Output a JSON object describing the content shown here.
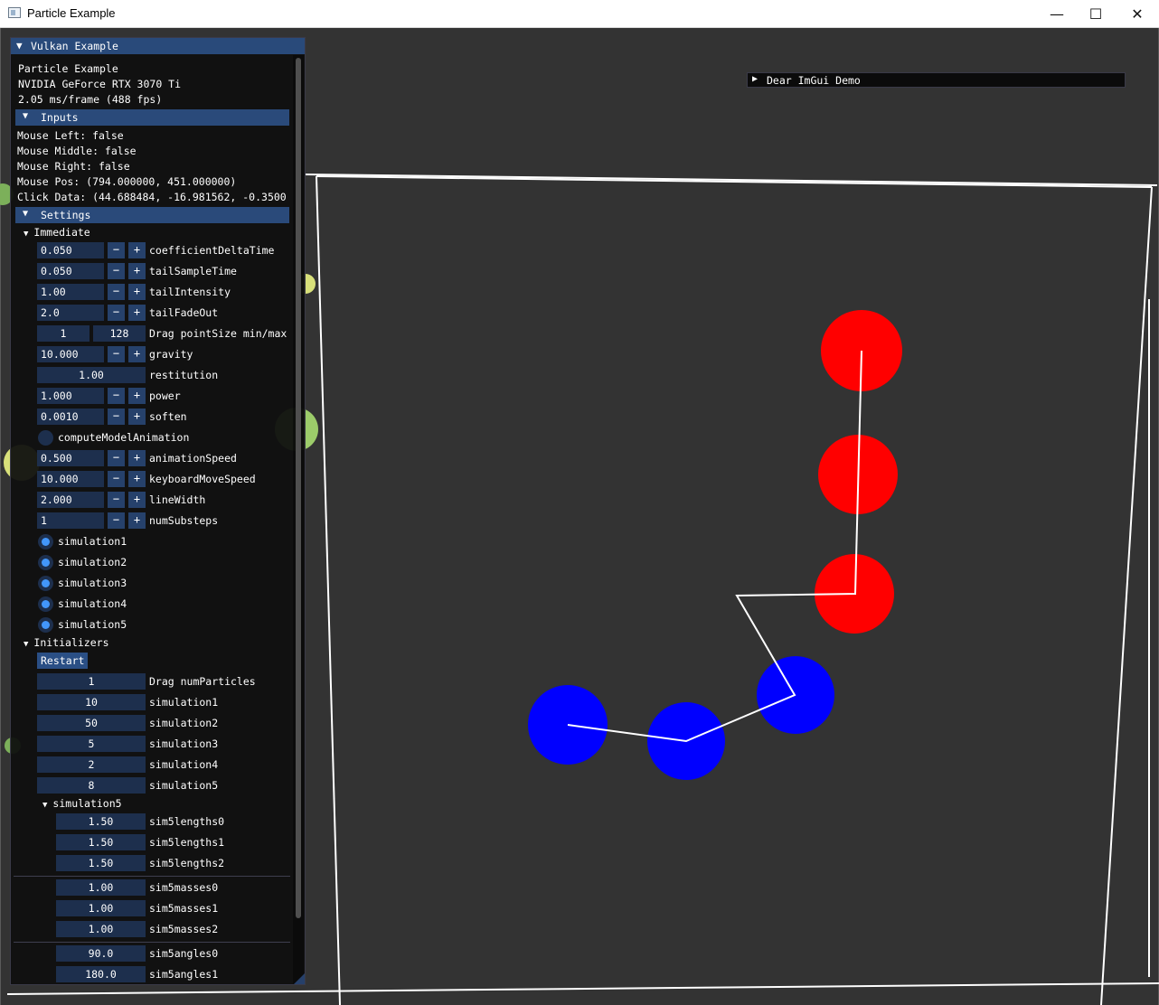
{
  "window": {
    "title": "Particle Example",
    "minimize": "—",
    "maximize": "☐",
    "close": "✕"
  },
  "imgui": {
    "title": "Vulkan Example",
    "info": [
      "Particle Example",
      "NVIDIA GeForce RTX 3070 Ti",
      "2.05 ms/frame (488 fps)"
    ],
    "inputs": {
      "header": "Inputs",
      "lines": [
        "Mouse Left: false",
        "Mouse Middle: false",
        "Mouse Right: false",
        "Mouse Pos: (794.000000, 451.000000)",
        "Click Data: (44.688484, -16.981562, -0.3500"
      ]
    },
    "settings": {
      "header": "Settings"
    },
    "immediate": {
      "label": "Immediate",
      "coefficientDeltaTime": {
        "value": "0.050",
        "label": "coefficientDeltaTime"
      },
      "tailSampleTime": {
        "value": "0.050",
        "label": "tailSampleTime"
      },
      "tailIntensity": {
        "value": "1.00",
        "label": "tailIntensity"
      },
      "tailFadeOut": {
        "value": "2.0",
        "label": "tailFadeOut"
      },
      "pointSize": {
        "min": "1",
        "max": "128",
        "label": "Drag pointSize min/max"
      },
      "gravity": {
        "value": "10.000",
        "label": "gravity"
      },
      "restitution": {
        "value": "1.00",
        "label": "restitution"
      },
      "power": {
        "value": "1.000",
        "label": "power"
      },
      "soften": {
        "value": "0.0010",
        "label": "soften"
      },
      "computeModelAnimation": {
        "label": "computeModelAnimation",
        "checked": false
      },
      "animationSpeed": {
        "value": "0.500",
        "label": "animationSpeed"
      },
      "keyboardMoveSpeed": {
        "value": "10.000",
        "label": "keyboardMoveSpeed"
      },
      "lineWidth": {
        "value": "2.000",
        "label": "lineWidth"
      },
      "numSubsteps": {
        "value": "1",
        "label": "numSubsteps"
      },
      "simulations": [
        "simulation1",
        "simulation2",
        "simulation3",
        "simulation4",
        "simulation5"
      ]
    },
    "stepper": {
      "minus": "−",
      "plus": "+"
    },
    "initializers": {
      "label": "Initializers",
      "restart": "Restart",
      "numParticles": {
        "value": "1",
        "label": "Drag numParticles"
      },
      "simulation1": {
        "value": "10",
        "label": "simulation1"
      },
      "simulation2": {
        "value": "50",
        "label": "simulation2"
      },
      "simulation3": {
        "value": "5",
        "label": "simulation3"
      },
      "simulation4": {
        "value": "2",
        "label": "simulation4"
      },
      "simulation5": {
        "value": "8",
        "label": "simulation5"
      },
      "sim5": {
        "label": "simulation5",
        "lengths": [
          {
            "value": "1.50",
            "label": "sim5lengths0"
          },
          {
            "value": "1.50",
            "label": "sim5lengths1"
          },
          {
            "value": "1.50",
            "label": "sim5lengths2"
          }
        ],
        "masses": [
          {
            "value": "1.00",
            "label": "sim5masses0"
          },
          {
            "value": "1.00",
            "label": "sim5masses1"
          },
          {
            "value": "1.00",
            "label": "sim5masses2"
          }
        ],
        "angles": [
          {
            "value": "90.0",
            "label": "sim5angles0"
          },
          {
            "value": "180.0",
            "label": "sim5angles1"
          }
        ]
      }
    }
  },
  "demo": {
    "label": "Dear ImGui Demo"
  },
  "colors": {
    "background": "#333333",
    "red_particle": "#ff0000",
    "blue_particle": "#0000ff",
    "imgui_header": "#294a7a",
    "radio_active": "#4296fa"
  }
}
